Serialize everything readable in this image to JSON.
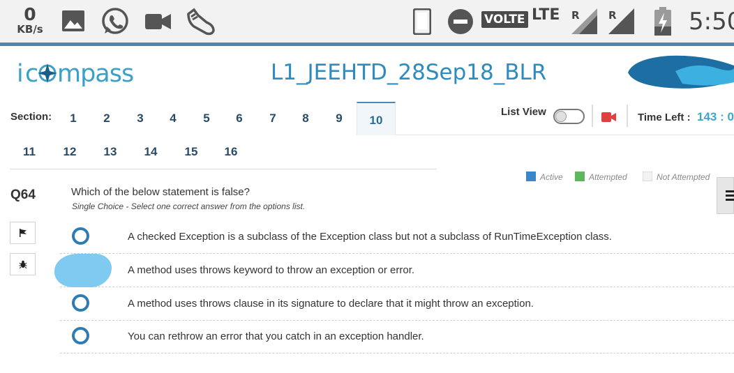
{
  "status_bar": {
    "data_rate": "0",
    "data_rate_unit": "KB/s",
    "volte": "VOLTE",
    "network": "LTE",
    "roaming_1": "R",
    "roaming_2": "R",
    "time": "5:50"
  },
  "header": {
    "logo_text": "icompass",
    "title": "L1_JEEHTD_28Sep18_BLR"
  },
  "sections": {
    "label": "Section:",
    "items": [
      "1",
      "2",
      "3",
      "4",
      "5",
      "6",
      "7",
      "8",
      "9",
      "10",
      "11",
      "12",
      "13",
      "14",
      "15",
      "16"
    ],
    "active": "10"
  },
  "controls": {
    "list_view_label": "List View",
    "list_view_on": false,
    "time_left_label": "Time Left :",
    "time_left_value": "143 : 0"
  },
  "legend": [
    {
      "label": "Active",
      "color": "#3a86c8"
    },
    {
      "label": "Attempted",
      "color": "#5cb85c"
    },
    {
      "label": "Not Attempted",
      "color": "#f2f2f2"
    }
  ],
  "question": {
    "number": "Q64",
    "text": "Which of the below statement is false?",
    "hint": "Single Choice - Select one correct answer from the options list.",
    "options": [
      "A checked Exception is a subclass of the Exception class but not a subclass of RunTimeException class.",
      "A method uses throws keyword to throw an exception or error.",
      "A method uses throws clause in its signature to declare that it might throw an exception.",
      "You can rethrow an error that you catch in an exception handler."
    ]
  },
  "colors": {
    "accent": "#2f7cb3",
    "title": "#2e8bbd",
    "timer": "#3ba6d0",
    "camera": "#e04040"
  }
}
